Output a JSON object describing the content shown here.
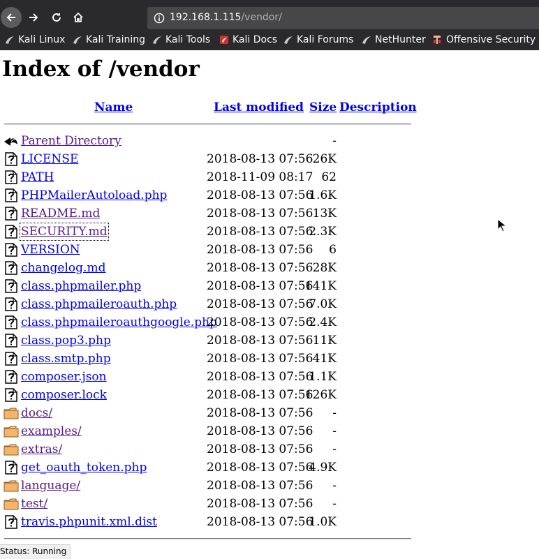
{
  "browser": {
    "url_host": "192.168.1.115",
    "url_path": "/vendor/",
    "bookmarks": [
      {
        "label": "Kali Linux",
        "icon": "kali-dragon-icon"
      },
      {
        "label": "Kali Training",
        "icon": "kali-dragon-icon"
      },
      {
        "label": "Kali Tools",
        "icon": "kali-dragon-icon"
      },
      {
        "label": "Kali Docs",
        "icon": "kali-docs-icon"
      },
      {
        "label": "Kali Forums",
        "icon": "kali-dragon-icon"
      },
      {
        "label": "NetHunter",
        "icon": "kali-dragon-icon"
      },
      {
        "label": "Offensive Security",
        "icon": "offsec-icon"
      }
    ]
  },
  "page": {
    "title": "Index of /vendor",
    "headers": {
      "name": "Name",
      "modified": "Last modified",
      "size": "Size",
      "description": "Description"
    },
    "rows": [
      {
        "name": "Parent Directory",
        "date": "",
        "size": "-",
        "icon": "back-arrow-icon",
        "visited": true
      },
      {
        "name": "LICENSE",
        "date": "2018-08-13 07:56",
        "size": "26K",
        "icon": "unknown-file-icon",
        "visited": false
      },
      {
        "name": "PATH",
        "date": "2018-11-09 08:17",
        "size": "62",
        "icon": "unknown-file-icon",
        "visited": false
      },
      {
        "name": "PHPMailerAutoload.php",
        "date": "2018-08-13 07:56",
        "size": "1.6K",
        "icon": "unknown-file-icon",
        "visited": false
      },
      {
        "name": "README.md",
        "date": "2018-08-13 07:56",
        "size": "13K",
        "icon": "unknown-file-icon",
        "visited": true
      },
      {
        "name": "SECURITY.md",
        "date": "2018-08-13 07:56",
        "size": "2.3K",
        "icon": "unknown-file-icon",
        "visited": true,
        "focused": true
      },
      {
        "name": "VERSION",
        "date": "2018-08-13 07:56",
        "size": "6",
        "icon": "unknown-file-icon",
        "visited": false
      },
      {
        "name": "changelog.md",
        "date": "2018-08-13 07:56",
        "size": "28K",
        "icon": "unknown-file-icon",
        "visited": false
      },
      {
        "name": "class.phpmailer.php",
        "date": "2018-08-13 07:56",
        "size": "141K",
        "icon": "unknown-file-icon",
        "visited": false
      },
      {
        "name": "class.phpmaileroauth.php",
        "date": "2018-08-13 07:56",
        "size": "7.0K",
        "icon": "unknown-file-icon",
        "visited": false
      },
      {
        "name": "class.phpmaileroauthgoogle.php",
        "date": "2018-08-13 07:56",
        "size": "2.4K",
        "icon": "unknown-file-icon",
        "visited": false
      },
      {
        "name": "class.pop3.php",
        "date": "2018-08-13 07:56",
        "size": "11K",
        "icon": "unknown-file-icon",
        "visited": false
      },
      {
        "name": "class.smtp.php",
        "date": "2018-08-13 07:56",
        "size": "41K",
        "icon": "unknown-file-icon",
        "visited": false
      },
      {
        "name": "composer.json",
        "date": "2018-08-13 07:56",
        "size": "1.1K",
        "icon": "unknown-file-icon",
        "visited": false
      },
      {
        "name": "composer.lock",
        "date": "2018-08-13 07:56",
        "size": "126K",
        "icon": "unknown-file-icon",
        "visited": false
      },
      {
        "name": "docs/",
        "date": "2018-08-13 07:56",
        "size": "-",
        "icon": "folder-icon",
        "visited": true
      },
      {
        "name": "examples/",
        "date": "2018-08-13 07:56",
        "size": "-",
        "icon": "folder-icon",
        "visited": true
      },
      {
        "name": "extras/",
        "date": "2018-08-13 07:56",
        "size": "-",
        "icon": "folder-icon",
        "visited": true
      },
      {
        "name": "get_oauth_token.php",
        "date": "2018-08-13 07:56",
        "size": "4.9K",
        "icon": "unknown-file-icon",
        "visited": false
      },
      {
        "name": "language/",
        "date": "2018-08-13 07:56",
        "size": "-",
        "icon": "folder-icon",
        "visited": true
      },
      {
        "name": "test/",
        "date": "2018-08-13 07:56",
        "size": "-",
        "icon": "folder-icon",
        "visited": true
      },
      {
        "name": "travis.phpunit.xml.dist",
        "date": "2018-08-13 07:56",
        "size": "1.0K",
        "icon": "unknown-file-icon",
        "visited": false
      }
    ]
  },
  "status": {
    "text": "Status: Running"
  },
  "colors": {
    "link": "#0000ee",
    "visited_link": "#551a8b",
    "chrome": "#2a2a2e"
  }
}
